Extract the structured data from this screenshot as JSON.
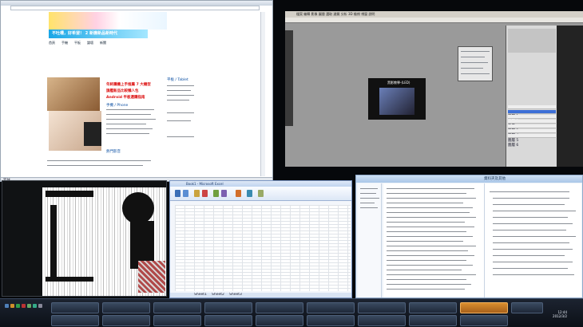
{
  "browser": {
    "tabs": [
      "首頁",
      "手機",
      "平板",
      "論壇",
      "新聞"
    ],
    "banner_text": "不吐槽，好希望！ 2 新機新品新時代",
    "headlines": [
      "年終購機上手推薦 7 大機型",
      "旗艦新品比較懶人包",
      "Android 平板選購指南"
    ],
    "sections": [
      "手機 / Phone",
      "平板 / Tablet",
      "熱門影音"
    ],
    "status_text": "完成"
  },
  "photoshop": {
    "menu": [
      "檔案",
      "編輯",
      "影像",
      "圖層",
      "選取",
      "濾鏡",
      "分析",
      "3D",
      "檢視",
      "視窗",
      "說明"
    ],
    "doc_label": "黑影教學-(LED)",
    "layers": [
      "圖層 1",
      "圖層 2",
      "背景",
      "圖層 3",
      "圖層 4",
      "圖層 5",
      "圖層 6"
    ]
  },
  "excel": {
    "title": "Book1 - Microsoft Excel",
    "sheet_tabs": [
      "Sheet1",
      "Sheet2",
      "Sheet3"
    ]
  },
  "explorer": {
    "title": "資料夾及其他"
  },
  "taskbar": {
    "clock_time": "12:44",
    "clock_date": "2012/3/2"
  },
  "colors": {
    "accent_orange": "#d98e2e",
    "taskbar_bg": "#0c1017"
  }
}
